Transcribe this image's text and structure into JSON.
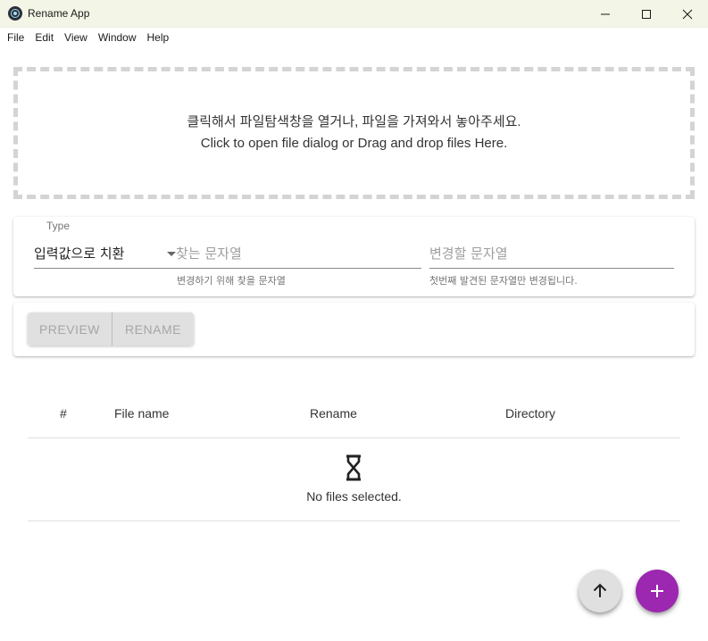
{
  "window": {
    "title": "Rename App",
    "icon": "electron-icon",
    "controls": [
      "minimize-icon",
      "maximize-icon",
      "close-icon"
    ]
  },
  "menu": [
    "File",
    "Edit",
    "View",
    "Window",
    "Help"
  ],
  "dropzone": {
    "line_ko": "클릭해서 파일탐색창을 열거나, 파일을 가져와서 놓아주세요.",
    "line_en": "Click to open file dialog or Drag and drop files Here."
  },
  "form": {
    "type_label": "Type",
    "type_value": "입력값으로 치환",
    "find_placeholder": "찾는 문자열",
    "find_helper": "변경하기 위해 찾을 문자열",
    "replace_placeholder": "변경할 문자열",
    "replace_helper": "첫번째 발견된 문자열만 변경됩니다."
  },
  "actions": {
    "preview_label": "PREVIEW",
    "rename_label": "RENAME"
  },
  "table": {
    "columns": [
      "#",
      "File name",
      "Rename",
      "Directory"
    ],
    "empty_text": "No files selected.",
    "empty_icon": "hourglass-icon"
  },
  "fabs": {
    "up_icon": "arrow-up-icon",
    "add_icon": "plus-icon",
    "add_color": "#9c27b0"
  },
  "colors": {
    "titlebar_bg": "#f3f6e6",
    "accent": "#9c27b0"
  }
}
